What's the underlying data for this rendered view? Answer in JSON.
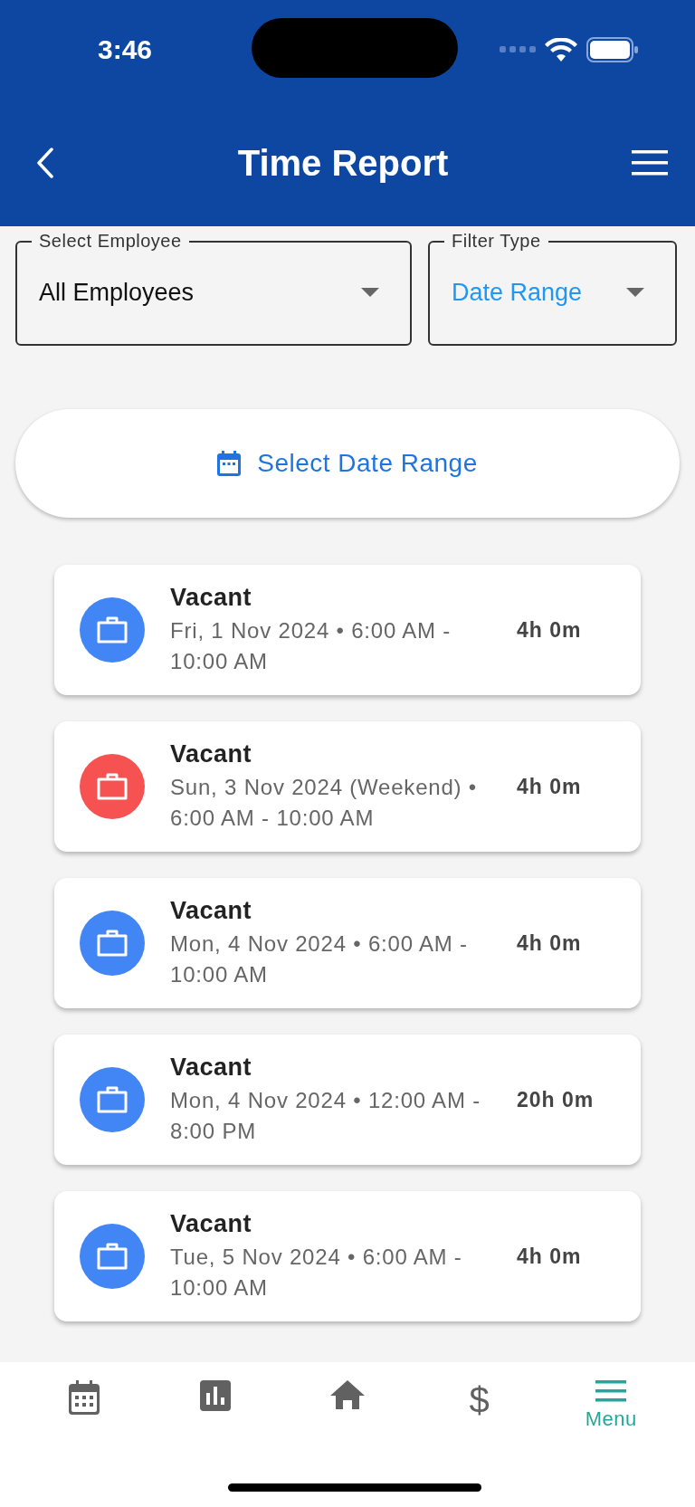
{
  "status_bar": {
    "time": "3:46"
  },
  "header": {
    "title": "Time Report"
  },
  "filters": [
    {
      "label": "Select Employee",
      "value": "All Employees",
      "highlighted": false
    },
    {
      "label": "Filter Type",
      "value": "Date Range",
      "highlighted": true
    }
  ],
  "date_range_button": {
    "label": "Select Date Range"
  },
  "entries": [
    {
      "title": "Vacant",
      "detail": "Fri, 1 Nov 2024 • 6:00 AM - 10:00 AM",
      "duration": "4h 0m",
      "color": "#4285f4"
    },
    {
      "title": "Vacant",
      "detail": "Sun, 3 Nov 2024 (Weekend) • 6:00 AM - 10:00 AM",
      "duration": "4h 0m",
      "color": "#f65252"
    },
    {
      "title": "Vacant",
      "detail": "Mon, 4 Nov 2024 • 6:00 AM - 10:00 AM",
      "duration": "4h 0m",
      "color": "#4285f4"
    },
    {
      "title": "Vacant",
      "detail": "Mon, 4 Nov 2024 • 12:00 AM - 8:00 PM",
      "duration": "20h 0m",
      "color": "#4285f4"
    },
    {
      "title": "Vacant",
      "detail": "Tue, 5 Nov 2024 • 6:00 AM - 10:00 AM",
      "duration": "4h 0m",
      "color": "#4285f4"
    }
  ],
  "bottom_nav": [
    {
      "kind": "calendar",
      "selected": false
    },
    {
      "kind": "chart",
      "selected": false
    },
    {
      "kind": "home",
      "selected": false
    },
    {
      "kind": "dollar",
      "glyph": "$",
      "selected": false
    },
    {
      "kind": "menu",
      "label": "Menu",
      "selected": true
    }
  ]
}
